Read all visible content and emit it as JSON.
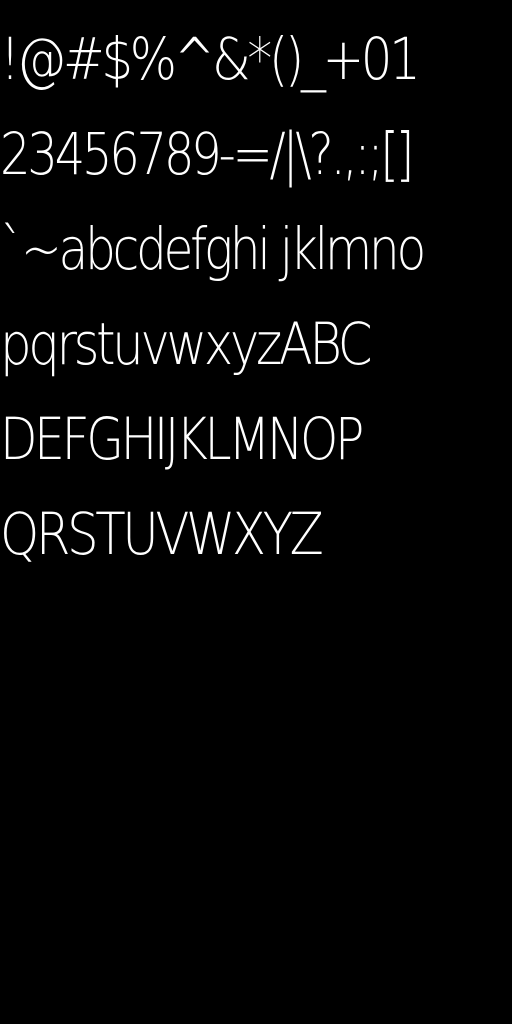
{
  "colors": {
    "background": "#000000",
    "text": "#ffffff"
  },
  "lines": [
    "!@#$%^&*()_+01",
    "23456789-=/|\\?.,:;[]",
    "`~abcdefghi jklmno",
    "pqrstuvwxyzABC",
    "DEFGHIJKLMNOP",
    "QRSTUVWXYZ"
  ]
}
